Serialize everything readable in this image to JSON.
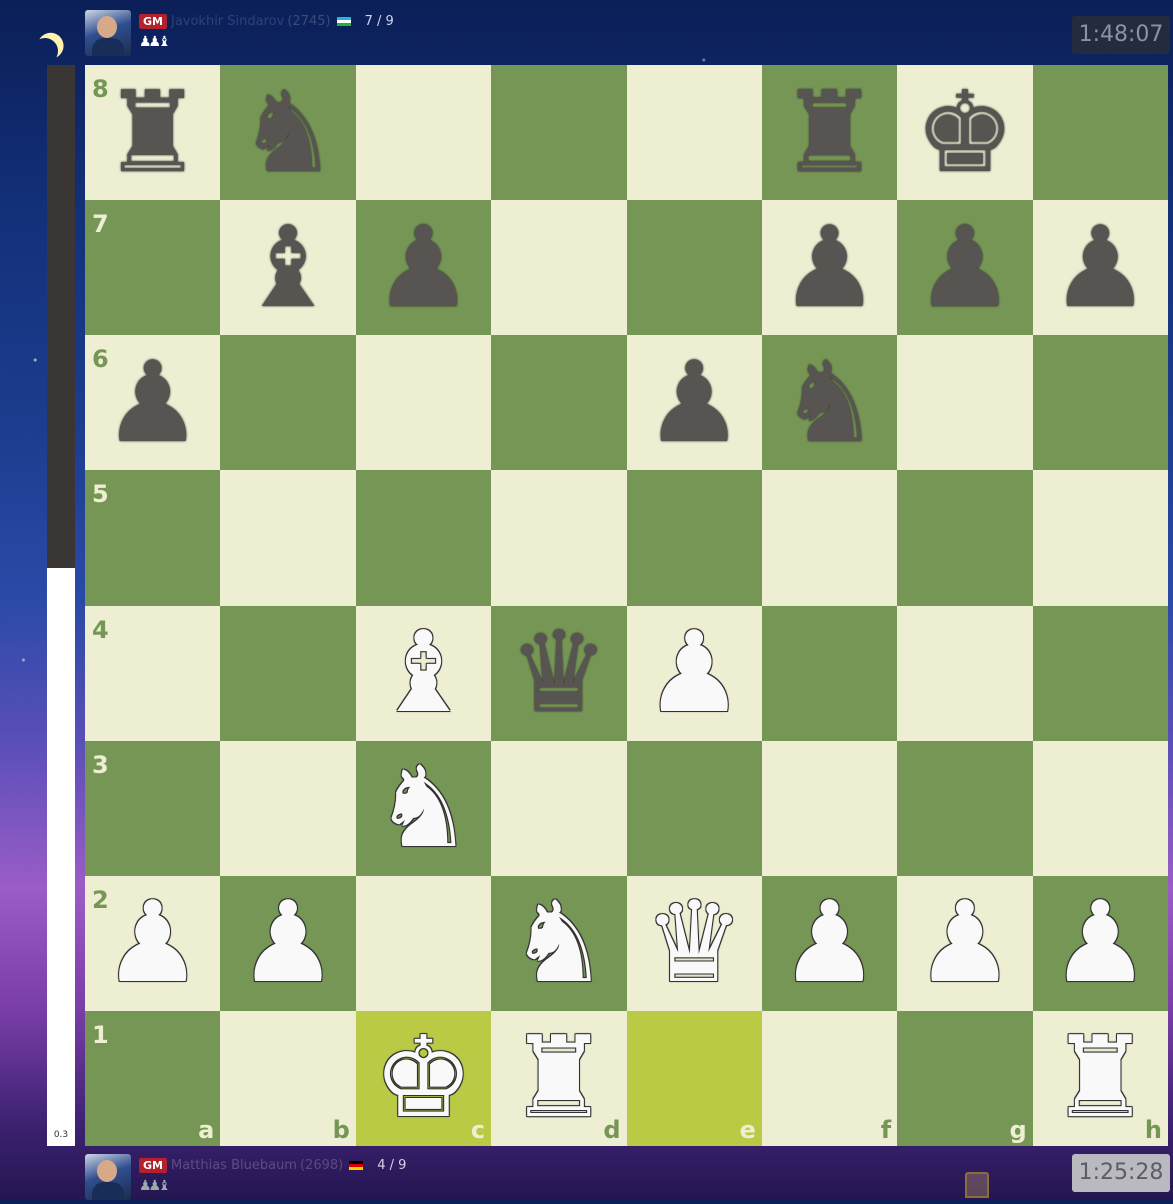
{
  "top_player": {
    "title": "GM",
    "name": "Javokhir Sindarov",
    "rating": "(2745)",
    "flag": "uz",
    "score": "7 / 9",
    "captured": "♟♟♝",
    "clock": "1:48:07"
  },
  "bottom_player": {
    "title": "GM",
    "name": "Matthias Bluebaum",
    "rating": "(2698)",
    "flag": "de",
    "score": "4 / 9",
    "captured": "♟♟♝",
    "clock": "1:25:28"
  },
  "eval": {
    "value": "0.3",
    "black_fraction": 0.465
  },
  "colors": {
    "light_square": "#eeeed2",
    "dark_square": "#769656",
    "highlight": "#baca44"
  },
  "board": {
    "files": [
      "a",
      "b",
      "c",
      "d",
      "e",
      "f",
      "g",
      "h"
    ],
    "ranks": [
      "8",
      "7",
      "6",
      "5",
      "4",
      "3",
      "2",
      "1"
    ],
    "highlighted": [
      "c1",
      "e1"
    ],
    "pieces": {
      "a8": "bR",
      "b8": "bN",
      "f8": "bR",
      "g8": "bK",
      "b7": "bB",
      "c7": "bP",
      "f7": "bP",
      "g7": "bP",
      "h7": "bP",
      "a6": "bP",
      "e6": "bP",
      "f6": "bN",
      "c4": "wB",
      "d4": "bQ",
      "e4": "wP",
      "c3": "wN",
      "a2": "wP",
      "b2": "wP",
      "d2": "wN",
      "e2": "wQ",
      "f2": "wP",
      "g2": "wP",
      "h2": "wP",
      "c1": "wK",
      "d1": "wR",
      "h1": "wR"
    }
  }
}
